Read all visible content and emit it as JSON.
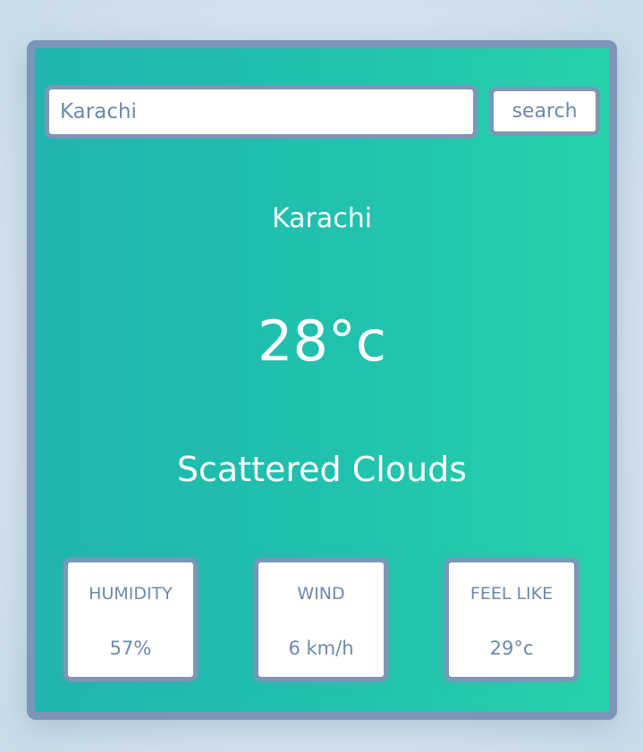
{
  "search": {
    "value": "Karachi",
    "button_label": "search"
  },
  "weather": {
    "city": "Karachi",
    "temperature": "28°c",
    "description": "Scattered Clouds"
  },
  "stats": {
    "humidity": {
      "label": "HUMIDITY",
      "value": "57%"
    },
    "wind": {
      "label": "WIND",
      "value": "6 km/h"
    },
    "feel_like": {
      "label": "FEEL LIKE",
      "value": "29°c"
    }
  },
  "colors": {
    "border": "#7c96b8",
    "text_muted": "#6d8aab",
    "gradient_start": "#1fb5b0",
    "gradient_end": "#27d2ab"
  }
}
